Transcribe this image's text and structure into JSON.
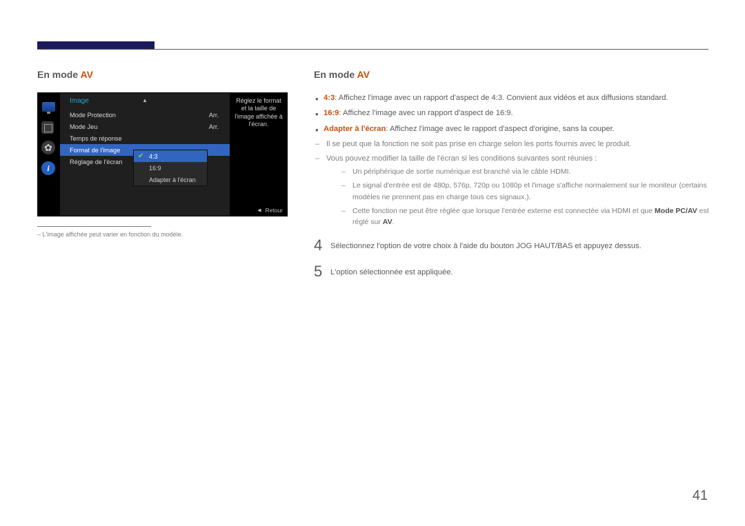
{
  "heading": {
    "prefix": "En mode ",
    "mode": "AV"
  },
  "osd": {
    "title": "Image",
    "rows": [
      {
        "label": "Mode Protection",
        "value": "Arr."
      },
      {
        "label": "Mode Jeu",
        "value": "Arr."
      },
      {
        "label": "Temps de réponse",
        "value": ""
      },
      {
        "label": "Format de l'image",
        "value": ""
      },
      {
        "label": "Réglage de l'écran",
        "value": ""
      }
    ],
    "submenu": [
      {
        "label": "4:3",
        "checked": true
      },
      {
        "label": "16:9",
        "checked": false
      },
      {
        "label": "Adapter à l'écran",
        "checked": false
      }
    ],
    "description": "Réglez le format et la taille de l'image affichée à l'écran.",
    "footer": "Retour"
  },
  "left_footnote": "L'image affichée peut varier en fonction du modèle.",
  "bullets": [
    {
      "lead": "4:3",
      "text": ": Affichez l'image avec un rapport d'aspect de 4:3. Convient aux vidéos et aux diffusions standard."
    },
    {
      "lead": "16:9",
      "text": ": Affichez l'image avec un rapport d'aspect de 16:9."
    },
    {
      "lead": "Adapter à l'écran",
      "text": ": Affichez l'image avec le rapport d'aspect d'origine, sans la couper."
    }
  ],
  "dashes": [
    "Il se peut que la fonction ne soit pas prise en charge selon les ports fournis avec le produit.",
    "Vous pouvez modifier la taille de l'écran si les conditions suivantes sont réunies :"
  ],
  "nested": [
    "Un périphérique de sortie numérique est branché via le câble HDMI.",
    "Le signal d'entrée est de 480p, 576p, 720p ou 1080p et l'image s'affiche normalement sur le moniteur (certains modèles ne prennent pas en charge tous ces signaux.)."
  ],
  "nested_last": {
    "pre": "Cette fonction ne peut être réglée que lorsque l'entrée externe est connectée via HDMI et que ",
    "bold1": "Mode PC/AV",
    "mid": " est réglé sur ",
    "bold2": "AV",
    "post": "."
  },
  "steps": [
    {
      "num": "4",
      "text": "Sélectionnez l'option de votre choix à l'aide du bouton JOG HAUT/BAS et appuyez dessus."
    },
    {
      "num": "5",
      "text": "L'option sélectionnée est appliquée."
    }
  ],
  "page": "41"
}
